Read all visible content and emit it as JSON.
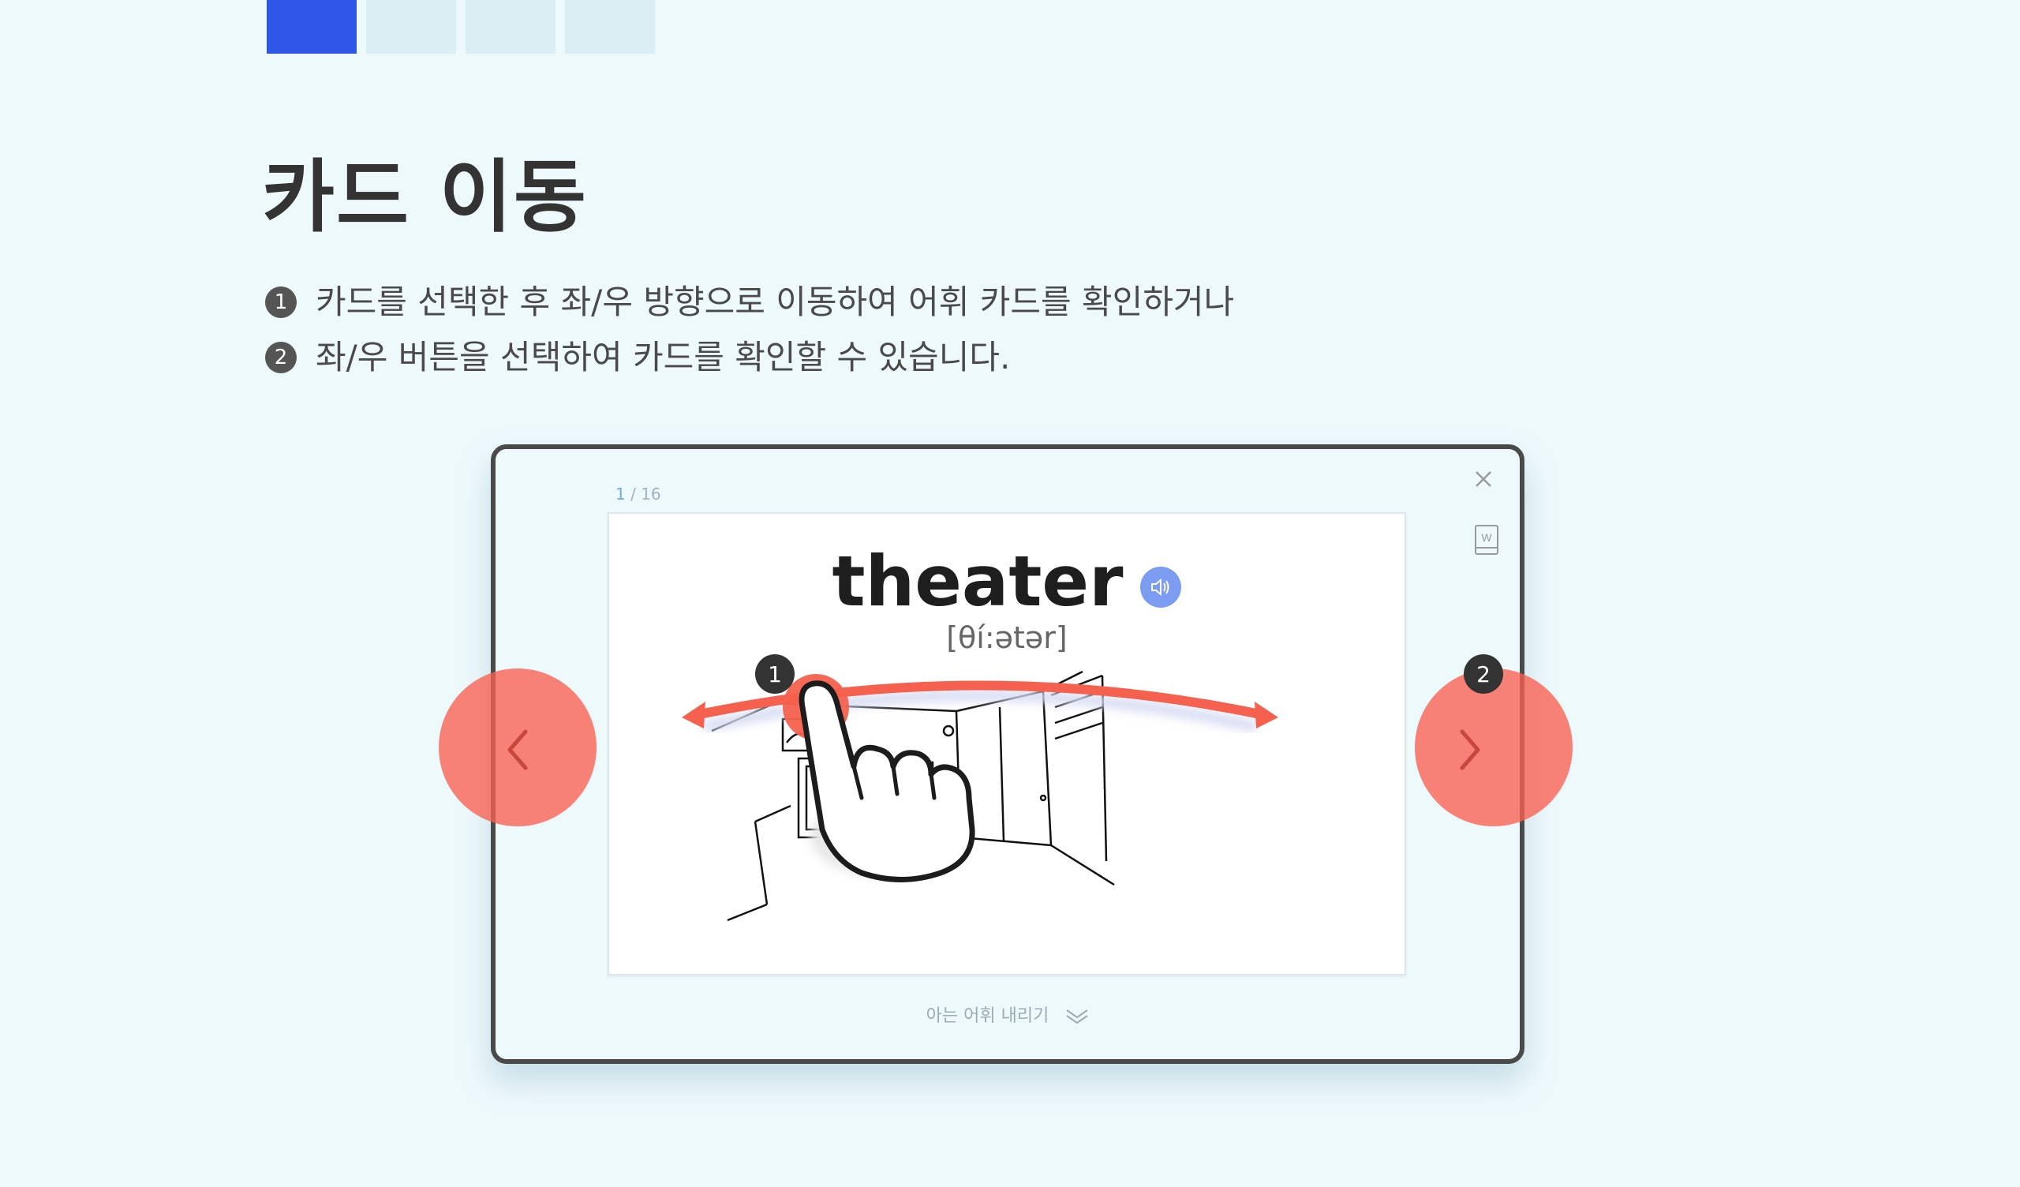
{
  "progress_tabs": [
    {
      "active": true
    },
    {
      "active": false
    },
    {
      "active": false
    },
    {
      "active": false
    }
  ],
  "page_title": "카드 이동",
  "instructions": [
    {
      "num": "1",
      "text": "카드를 선택한 후 좌/우 방향으로 이동하여 어휘 카드를 확인하거나"
    },
    {
      "num": "2",
      "text": "좌/우 버튼을 선택하여 카드를 확인할 수 있습니다."
    }
  ],
  "viewer": {
    "counter_current": "1",
    "counter_sep": " / ",
    "counter_total": "16",
    "card": {
      "word": "theater",
      "phonetic": "[θí:ətər]"
    },
    "know_word_label": "아는 어휘 내리기"
  },
  "callouts": [
    "1",
    "2"
  ],
  "icons": {
    "close": "close-icon",
    "wordbook": "wordbook-icon",
    "speaker": "speaker-icon",
    "prev": "chevron-left-icon",
    "next": "chevron-right-icon",
    "swipe_hand": "hand-pointer-icon",
    "double_chevron": "double-chevron-down-icon"
  },
  "colors": {
    "accent": "#2e57e8",
    "nav_circle": "#fa5f50",
    "swipe_arrow": "#f5614e",
    "speaker": "#7b9cf0"
  }
}
